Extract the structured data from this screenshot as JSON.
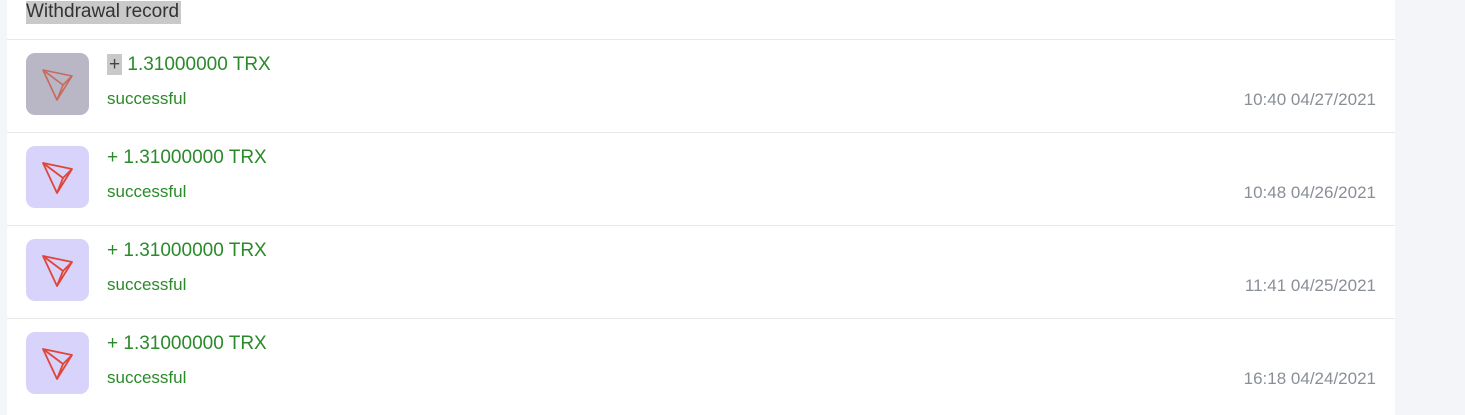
{
  "header": {
    "title": "Withdrawal record"
  },
  "records": [
    {
      "sign": "+",
      "amount": "1.31000000 TRX",
      "status": "successful",
      "time": "10:40 04/27/2021",
      "icon": "tron-icon"
    },
    {
      "sign": "+",
      "amount": "1.31000000 TRX",
      "status": "successful",
      "time": "10:48 04/26/2021",
      "icon": "tron-icon"
    },
    {
      "sign": "+",
      "amount": "1.31000000 TRX",
      "status": "successful",
      "time": "11:41 04/25/2021",
      "icon": "tron-icon"
    },
    {
      "sign": "+",
      "amount": "1.31000000 TRX",
      "status": "successful",
      "time": "16:18 04/24/2021",
      "icon": "tron-icon"
    }
  ],
  "colors": {
    "success_green": "#2a8a2a",
    "icon_bg": "#d8d3fb",
    "tron_red": "#e0453a",
    "time_gray": "#8a8f96"
  }
}
